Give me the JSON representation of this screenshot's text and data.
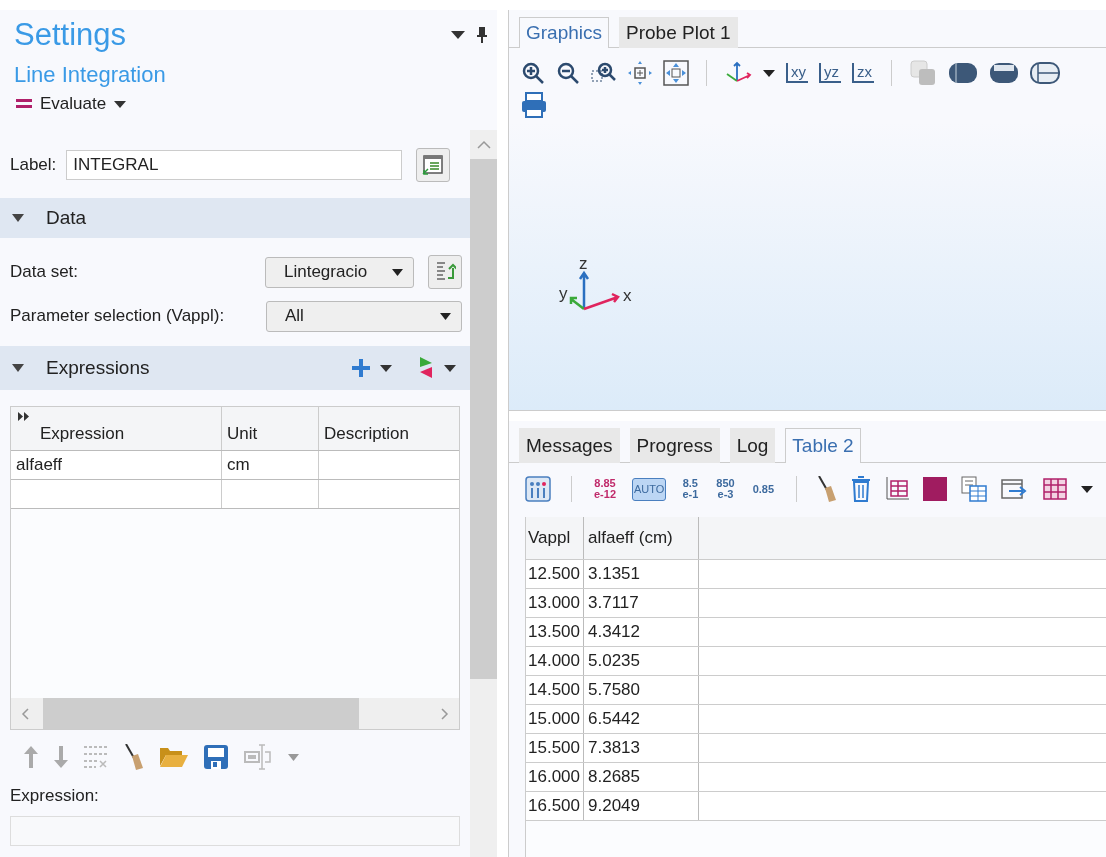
{
  "settings": {
    "title": "Settings",
    "subtitle": "Line Integration",
    "evaluate_button": "Evaluate",
    "label_field": {
      "label": "Label:",
      "value": "INTEGRAL"
    },
    "data_section": {
      "title": "Data",
      "expanded": true,
      "data_set": {
        "label": "Data set:",
        "value": "Lintegracio"
      },
      "parameter_selection": {
        "label": "Parameter selection (Vappl):",
        "value": "All"
      }
    },
    "expressions_section": {
      "title": "Expressions",
      "expanded": true,
      "columns": [
        "Expression",
        "Unit",
        "Description"
      ],
      "rows": [
        {
          "expression": "alfaeff",
          "unit": "cm"
        }
      ]
    },
    "expression_field": {
      "label": "Expression:"
    }
  },
  "graphics": {
    "tabs": [
      {
        "label": "Graphics",
        "selected": true
      },
      {
        "label": "Probe Plot 1",
        "selected": false
      }
    ],
    "view_buttons": [
      "xy",
      "yz",
      "zx"
    ],
    "axes": {
      "x": "x",
      "y": "y",
      "z": "z"
    }
  },
  "results": {
    "tabs": [
      {
        "label": "Messages",
        "selected": false
      },
      {
        "label": "Progress",
        "selected": false
      },
      {
        "label": "Log",
        "selected": false
      },
      {
        "label": "Table 2",
        "selected": true
      }
    ],
    "format_buttons": [
      {
        "lines": [
          "8.85",
          "e-12"
        ],
        "selected": false
      },
      {
        "lines": [
          "AUTO"
        ],
        "selected": true
      },
      {
        "lines": [
          "8.5",
          "e-1"
        ],
        "selected": false
      },
      {
        "lines": [
          "850",
          "e-3"
        ],
        "selected": false
      },
      {
        "lines": [
          "0.85"
        ],
        "selected": false
      }
    ],
    "table": {
      "columns": [
        "Vappl",
        "alfaeff (cm)"
      ],
      "rows": [
        [
          "12.500",
          "3.1351"
        ],
        [
          "13.000",
          "3.7117"
        ],
        [
          "13.500",
          "4.3412"
        ],
        [
          "14.000",
          "5.0235"
        ],
        [
          "14.500",
          "5.7580"
        ],
        [
          "15.000",
          "6.5442"
        ],
        [
          "15.500",
          "7.3813"
        ],
        [
          "16.000",
          "8.2685"
        ],
        [
          "16.500",
          "9.2049"
        ]
      ]
    }
  }
}
